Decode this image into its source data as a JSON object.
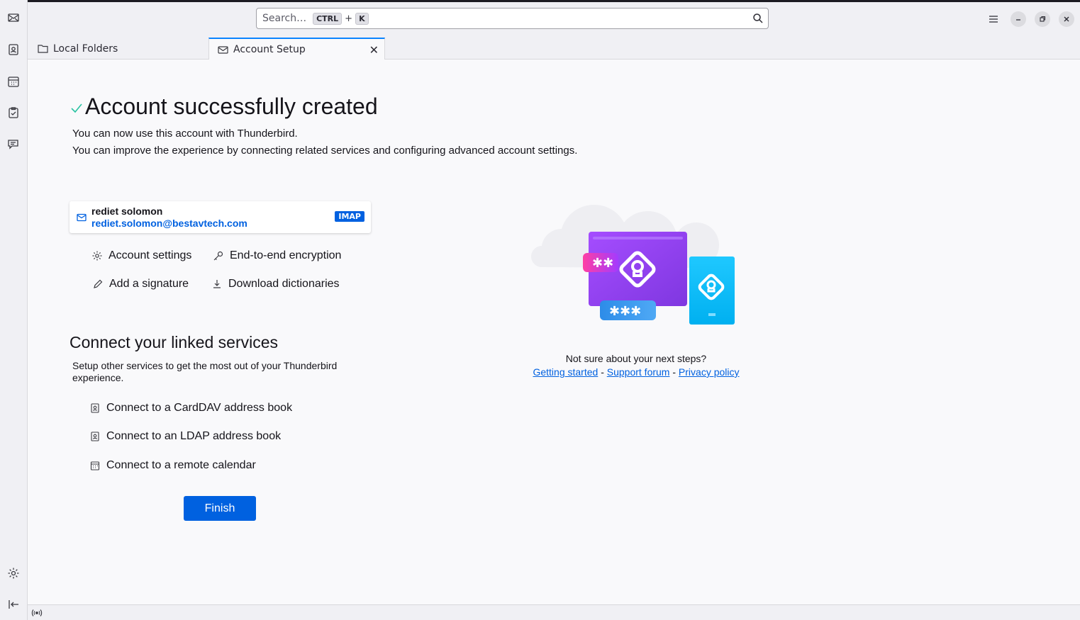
{
  "search": {
    "placeholder": "Search…",
    "key1": "CTRL",
    "plus": "+",
    "key2": "K"
  },
  "tabs": [
    {
      "label": "Local Folders",
      "icon": "folder-icon"
    },
    {
      "label": "Account Setup",
      "icon": "mail-icon",
      "active": true
    }
  ],
  "page": {
    "title": "Account successfully created",
    "intro1": "You can now use this account with Thunderbird.",
    "intro2": "You can improve the experience by connecting related services and configuring advanced account settings."
  },
  "account": {
    "name": "rediet solomon",
    "email": "rediet.solomon@bestavtech.com",
    "type": "IMAP"
  },
  "actions": [
    {
      "label": "Account settings",
      "icon": "gear-icon"
    },
    {
      "label": "End-to-end encryption",
      "icon": "key-icon"
    },
    {
      "label": "Add a signature",
      "icon": "pencil-icon"
    },
    {
      "label": "Download dictionaries",
      "icon": "download-icon"
    }
  ],
  "connect": {
    "heading": "Connect your linked services",
    "description": "Setup other services to get the most out of your Thunderbird experience.",
    "items": [
      {
        "label": "Connect to a CardDAV address book",
        "icon": "address-book-icon"
      },
      {
        "label": "Connect to an LDAP address book",
        "icon": "address-book-icon"
      },
      {
        "label": "Connect to a remote calendar",
        "icon": "calendar-icon"
      }
    ]
  },
  "finish_label": "Finish",
  "help": {
    "question": "Not sure about your next steps?",
    "links": [
      "Getting started",
      "Support forum",
      "Privacy policy"
    ],
    "separator": "-"
  },
  "colors": {
    "accent": "#0061e0",
    "tab_highlight": "#0a84ff",
    "check": "#2ac3a2"
  }
}
